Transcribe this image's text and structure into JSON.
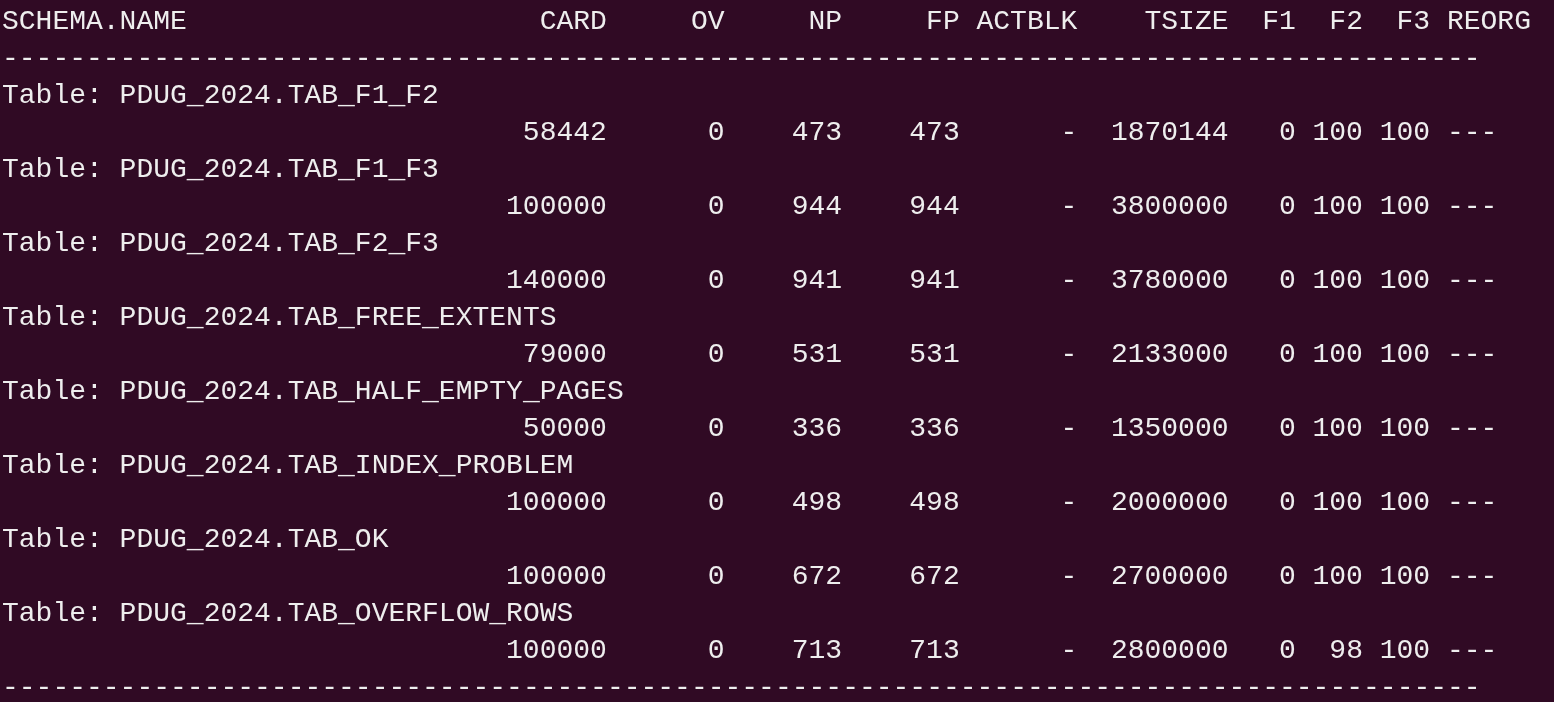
{
  "header": {
    "columns": [
      "SCHEMA.NAME",
      "CARD",
      "OV",
      "NP",
      "FP",
      "ACTBLK",
      "TSIZE",
      "F1",
      "F2",
      "F3",
      "REORG"
    ]
  },
  "separator_top": "----------------------------------------------------------------------------------------",
  "tables": [
    {
      "name": "Table: PDUG_2024.TAB_F1_F2",
      "values": [
        "58442",
        "0",
        "473",
        "473",
        "-",
        "1870144",
        "0",
        "100",
        "100",
        "---"
      ]
    },
    {
      "name": "Table: PDUG_2024.TAB_F1_F3",
      "values": [
        "100000",
        "0",
        "944",
        "944",
        "-",
        "3800000",
        "0",
        "100",
        "100",
        "---"
      ]
    },
    {
      "name": "Table: PDUG_2024.TAB_F2_F3",
      "values": [
        "140000",
        "0",
        "941",
        "941",
        "-",
        "3780000",
        "0",
        "100",
        "100",
        "---"
      ]
    },
    {
      "name": "Table: PDUG_2024.TAB_FREE_EXTENTS",
      "values": [
        "79000",
        "0",
        "531",
        "531",
        "-",
        "2133000",
        "0",
        "100",
        "100",
        "---"
      ]
    },
    {
      "name": "Table: PDUG_2024.TAB_HALF_EMPTY_PAGES",
      "values": [
        "50000",
        "0",
        "336",
        "336",
        "-",
        "1350000",
        "0",
        "100",
        "100",
        "---"
      ]
    },
    {
      "name": "Table: PDUG_2024.TAB_INDEX_PROBLEM",
      "values": [
        "100000",
        "0",
        "498",
        "498",
        "-",
        "2000000",
        "0",
        "100",
        "100",
        "---"
      ]
    },
    {
      "name": "Table: PDUG_2024.TAB_OK",
      "values": [
        "100000",
        "0",
        "672",
        "672",
        "-",
        "2700000",
        "0",
        "100",
        "100",
        "---"
      ]
    },
    {
      "name": "Table: PDUG_2024.TAB_OVERFLOW_ROWS",
      "values": [
        "100000",
        "0",
        "713",
        "713",
        "-",
        "2800000",
        "0",
        "98",
        "100",
        "---"
      ]
    }
  ],
  "separator_bottom": "----------------------------------------------------------------------------------------"
}
